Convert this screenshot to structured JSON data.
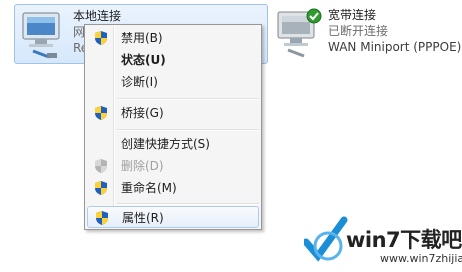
{
  "connections": [
    {
      "title": "本地连接",
      "line2": "网",
      "line3": "Re",
      "icon": "network-computer-icon",
      "selected": true
    },
    {
      "title": "宽带连接",
      "line2": "已断开连接",
      "line3": "WAN Miniport (PPPOE)",
      "icon": "broadband-computer-icon",
      "status_icon": "green-check-icon"
    }
  ],
  "context_menu": {
    "items": [
      {
        "label": "禁用(B)",
        "icon": "uac-shield-icon"
      },
      {
        "label": "状态(U)",
        "bold": true
      },
      {
        "label": "诊断(I)"
      },
      {
        "label": "桥接(G)",
        "icon": "uac-shield-icon"
      },
      {
        "label": "创建快捷方式(S)"
      },
      {
        "label": "删除(D)",
        "icon": "uac-shield-icon",
        "disabled": true
      },
      {
        "label": "重命名(M)",
        "icon": "uac-shield-icon"
      },
      {
        "label": "属性(R)",
        "icon": "uac-shield-icon",
        "hover": true
      }
    ]
  },
  "watermark": {
    "brand": "win7下载吧",
    "url": "www.win7zhijia.cn",
    "logo": "blue-checkmark-logo"
  }
}
